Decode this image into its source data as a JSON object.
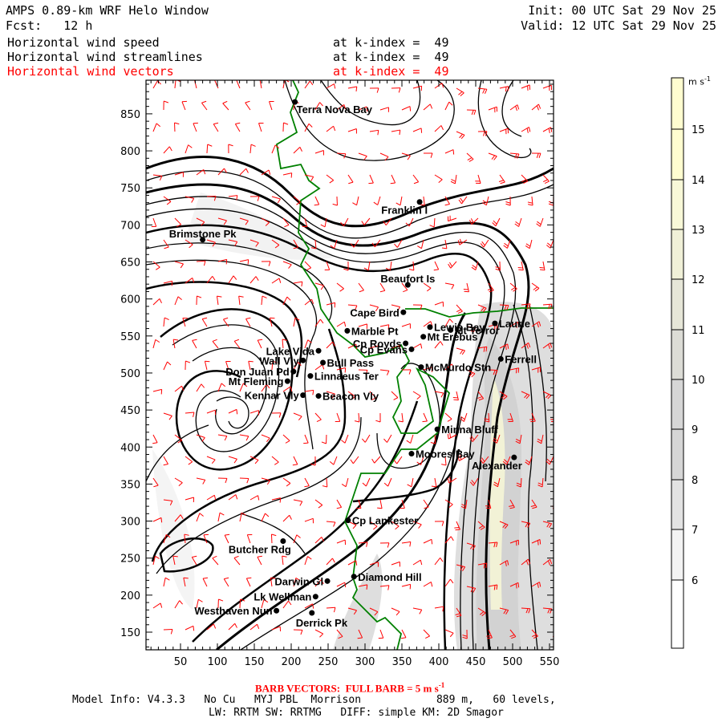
{
  "header": {
    "title": "AMPS 0.89-km WRF Helo Window",
    "fcst_label": "Fcst:",
    "fcst_value": "12 h",
    "init": "Init: 00 UTC Sat 29 Nov 25",
    "valid": "Valid: 12 UTC Sat 29 Nov 25",
    "fields": [
      {
        "name": "Horizontal wind speed",
        "level": "at k-index =  49"
      },
      {
        "name": "Horizontal wind streamlines",
        "level": "at k-index =  49"
      },
      {
        "name": "Horizontal wind vectors",
        "level": "at k-index =  49"
      }
    ]
  },
  "colors": {
    "barbs": "#ff0000",
    "coast": "#008000",
    "streamlines": "#000000",
    "highlight_text": "#ff0000"
  },
  "chart_data": {
    "type": "map",
    "xlim": [
      0,
      555
    ],
    "ylim": [
      125,
      895
    ],
    "x_ticks": [
      "50",
      "100",
      "150",
      "200",
      "250",
      "300",
      "350",
      "400",
      "450",
      "500",
      "550"
    ],
    "y_ticks": [
      "150",
      "200",
      "250",
      "300",
      "350",
      "400",
      "450",
      "500",
      "550",
      "600",
      "650",
      "700",
      "750",
      "800",
      "850"
    ],
    "places": [
      {
        "name": "Terra Nova Bay",
        "x": 205,
        "y": 866,
        "anchor": "right-below"
      },
      {
        "name": "Franklin I",
        "x": 374,
        "y": 731,
        "anchor": "below-left"
      },
      {
        "name": "Brimstone Pk",
        "x": 80,
        "y": 680,
        "anchor": "above"
      },
      {
        "name": "Beaufort Is",
        "x": 358,
        "y": 619,
        "anchor": "above"
      },
      {
        "name": "Cape Bird",
        "x": 352,
        "y": 582,
        "anchor": "left"
      },
      {
        "name": "Lewis Bay",
        "x": 388,
        "y": 562,
        "anchor": "right"
      },
      {
        "name": "Mt Terror",
        "x": 416,
        "y": 558,
        "anchor": "right"
      },
      {
        "name": "Laurie",
        "x": 476,
        "y": 567,
        "anchor": "right"
      },
      {
        "name": "Marble Pt",
        "x": 276,
        "y": 557,
        "anchor": "right"
      },
      {
        "name": "Mt Erebus",
        "x": 379,
        "y": 549,
        "anchor": "right"
      },
      {
        "name": "Cp Royds",
        "x": 355,
        "y": 540,
        "anchor": "left"
      },
      {
        "name": "Cp Evans",
        "x": 363,
        "y": 532,
        "anchor": "left"
      },
      {
        "name": "Ferrell",
        "x": 484,
        "y": 519,
        "anchor": "right"
      },
      {
        "name": "McMurdo Stn",
        "x": 376,
        "y": 508,
        "anchor": "right"
      },
      {
        "name": "Lake Vida",
        "x": 237,
        "y": 530,
        "anchor": "left"
      },
      {
        "name": "Wall Vly",
        "x": 216,
        "y": 517,
        "anchor": "left"
      },
      {
        "name": "Bull Pass",
        "x": 243,
        "y": 514,
        "anchor": "right"
      },
      {
        "name": "Don Juan Pd",
        "x": 203,
        "y": 502,
        "anchor": "left"
      },
      {
        "name": "Mt Fleming",
        "x": 195,
        "y": 489,
        "anchor": "left"
      },
      {
        "name": "Linnaeus Ter",
        "x": 226,
        "y": 496,
        "anchor": "right"
      },
      {
        "name": "Kennar Vly",
        "x": 216,
        "y": 470,
        "anchor": "left"
      },
      {
        "name": "Beacon Vly",
        "x": 237,
        "y": 469,
        "anchor": "right"
      },
      {
        "name": "Minna Bluff",
        "x": 398,
        "y": 424,
        "anchor": "right"
      },
      {
        "name": "Moores Bay",
        "x": 363,
        "y": 391,
        "anchor": "right"
      },
      {
        "name": "Alexander",
        "x": 502,
        "y": 386,
        "anchor": "below-left"
      },
      {
        "name": "Cp Lankester",
        "x": 277,
        "y": 301,
        "anchor": "right"
      },
      {
        "name": "Butcher Rdg",
        "x": 189,
        "y": 273,
        "anchor": "below-left"
      },
      {
        "name": "Darwin Gl",
        "x": 249,
        "y": 219,
        "anchor": "left"
      },
      {
        "name": "Diamond Hill",
        "x": 285,
        "y": 225,
        "anchor": "right"
      },
      {
        "name": "Lk Wellman",
        "x": 233,
        "y": 198,
        "anchor": "left"
      },
      {
        "name": "Westhaven Nun",
        "x": 180,
        "y": 179,
        "anchor": "left"
      },
      {
        "name": "Derrick Pk",
        "x": 228,
        "y": 176,
        "anchor": "below"
      }
    ]
  },
  "colorbar": {
    "unit": "m s",
    "unit_exp": "-1",
    "levels": [
      "6",
      "7",
      "8",
      "9",
      "10",
      "11",
      "12",
      "13",
      "14",
      "15"
    ],
    "fills": [
      "#ffffff",
      "#f3f3f3",
      "#e2e2e2",
      "#d6d6d6",
      "#d6d6d6",
      "#dcdcd6",
      "#e6e6d8",
      "#f0f0d8",
      "#f8f8d8",
      "#fffdd0",
      "#fffdd0"
    ]
  },
  "footer": {
    "barb_note": "BARB VECTORS:  FULL BARB = 5 m s",
    "barb_note_exp": "-1",
    "model_info_1": "Model Info: V4.3.3   No Cu   MYJ PBL  Morrison            889 m,   60 levels,",
    "model_info_2": "LW: RRTM SW: RRTMG   DIFF: simple KM: 2D Smagor"
  }
}
